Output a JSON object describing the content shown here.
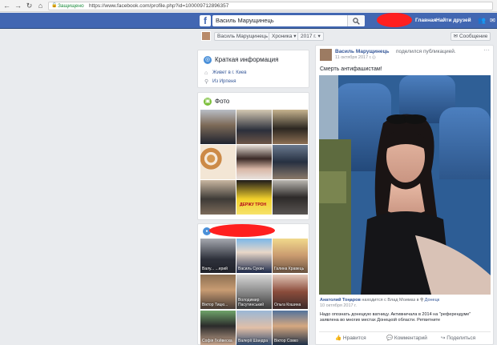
{
  "browser": {
    "back_icon": "back-arrow-icon",
    "forward_icon": "forward-arrow-icon",
    "reload_icon": "reload-icon",
    "home_icon": "home-icon",
    "secure_label": "Защищено",
    "url": "https://www.facebook.com/profile.php?id=100009712896357"
  },
  "header": {
    "logo": "f",
    "search_value": "Василь Марущинець",
    "links": [
      "Главная",
      "Найти друзей"
    ],
    "redaction_color": "#ff1f1f"
  },
  "subbar": {
    "name": "Василь Марущинець",
    "timeline": "Хроника",
    "year": "2017 г.",
    "message": "Сообщение"
  },
  "about": {
    "title": "Краткая информация",
    "lives": "Живет в г. Киев",
    "from": "Из Ирпеня"
  },
  "photos": {
    "title": "Фото",
    "tile_labels": [
      "ДЕРЖУ ТРОН"
    ]
  },
  "friends": {
    "names": [
      "Валу... ...ерий",
      "Василь Сукач",
      "Галина Кравець",
      "Віктор Тицю...",
      "Володимир Пасутинський",
      "Ольга Кошина",
      "Софія Гюйвеска",
      "Валерії Шандра",
      "Віктор Совко"
    ]
  },
  "post": {
    "author": "Василь Марущинець",
    "action": "поделился публикацией.",
    "date": "11 октября 2017 г.",
    "text": "Смерть антифашистам!",
    "shared_author": "Анатолий Тоңаров",
    "shared_action": "находится с Влад Моимаз в",
    "shared_place": "Донецк",
    "shared_date": "10 октября 2017 г.",
    "shared_body": "Надо опознать донецкую ватницу. Активничала в 2014 на \"референдуме\" заявлена во многих местах Донецкой области. Ретвитните",
    "like": "Нравится",
    "comment": "Комментарий",
    "share": "Поделиться"
  },
  "colors": {
    "fb_blue": "#4267b2",
    "link": "#365899",
    "red": "#ff1f1f"
  }
}
